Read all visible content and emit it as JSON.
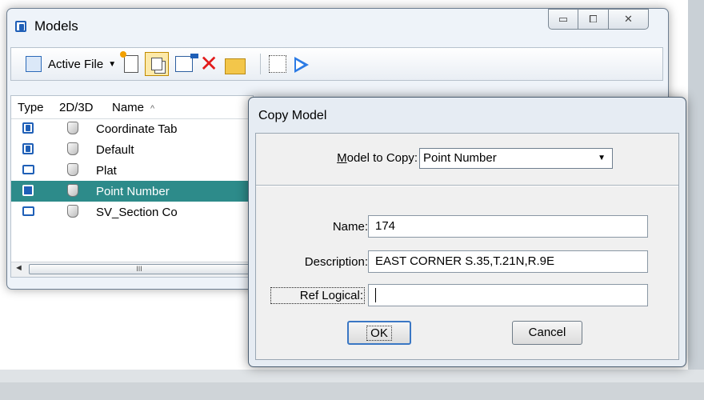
{
  "models_window": {
    "title": "Models",
    "icon": "model-window-icon",
    "caption_buttons": {
      "minimize": "▭",
      "restore": "⧠",
      "close": "✕"
    }
  },
  "toolbar": {
    "active_file_label": "Active File",
    "dropdown_glyph": "▼",
    "icons": [
      "model-tree-icon",
      "new-model-icon",
      "copy-model-icon",
      "model-properties-icon",
      "delete-icon",
      "import-model-icon",
      "select-area-icon",
      "shape-icon"
    ]
  },
  "list": {
    "headers": {
      "type": "Type",
      "dim": "2D/3D",
      "name": "Name",
      "sort_glyph": "^"
    },
    "rows": [
      {
        "type": "design",
        "dim": "3d",
        "name": "Coordinate Tab",
        "selected": false
      },
      {
        "type": "design",
        "dim": "3d",
        "name": "Default",
        "selected": false
      },
      {
        "type": "sheet",
        "dim": "3d",
        "name": "Plat",
        "selected": false
      },
      {
        "type": "design",
        "dim": "3d",
        "name": "Point Number",
        "selected": true
      },
      {
        "type": "sheet",
        "dim": "3d",
        "name": "SV_Section Co",
        "selected": false
      }
    ],
    "scroll_left_glyph": "◄",
    "scroll_thumb_glyph": "III"
  },
  "copy_dialog": {
    "title": "Copy Model",
    "model_to_copy_label": "Model to Copy:",
    "model_to_copy_value": "Point Number",
    "dropdown_glyph": "▼",
    "name_label": "Name:",
    "name_value": "174",
    "description_label": "Description:",
    "description_value": "EAST CORNER S.35,T.21N,R.9E",
    "ref_logical_label": "Ref Logical:",
    "ref_logical_value": "",
    "ok_label": "OK",
    "cancel_label": "Cancel"
  },
  "colors": {
    "selection": "#2d8b8a",
    "model_icon_blue": "#1f5fb7",
    "delete_red": "#e21b1b"
  }
}
